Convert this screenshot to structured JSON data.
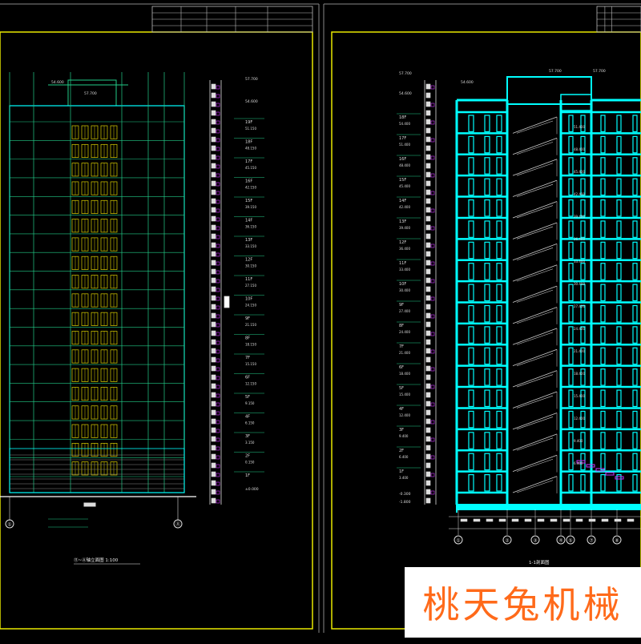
{
  "colors": {
    "background": "#000000",
    "frame": "#e8e800",
    "structure": "#00ffff",
    "elevation": "#22cc88",
    "stairs": "#cccccc",
    "highlight": "#cc33ff",
    "text": "#dddddd",
    "watermark_text": "#ff6a1a"
  },
  "left_sheet": {
    "top_elevation": "57.700",
    "roof_elevation": "54.600",
    "ground_elevation": "±0.000",
    "floor_labels": [
      "19F",
      "18F",
      "17F",
      "16F",
      "15F",
      "14F",
      "13F",
      "12F",
      "11F",
      "10F",
      "9F",
      "8F",
      "7F",
      "6F",
      "5F",
      "4F",
      "3F",
      "2F",
      "1F"
    ],
    "floor_elevations": [
      "51.150",
      "48.150",
      "45.150",
      "42.150",
      "39.150",
      "36.150",
      "33.150",
      "30.150",
      "27.150",
      "24.150",
      "21.150",
      "18.150",
      "15.150",
      "12.150",
      "9.150",
      "6.150",
      "3.150",
      "0.150"
    ],
    "axis_left": "①",
    "axis_right": "Ⓐ",
    "title": "⑪~Ⓐ轴立面图  1:100"
  },
  "right_sheet": {
    "top_elevation": "57.700",
    "roof_elevation": "54.600",
    "floor_labels": [
      "18F",
      "17F",
      "16F",
      "15F",
      "14F",
      "13F",
      "12F",
      "11F",
      "10F",
      "9F",
      "8F",
      "7F",
      "6F",
      "5F",
      "4F",
      "3F",
      "2F",
      "1F"
    ],
    "floor_elevations": [
      "54.400",
      "51.400",
      "48.400",
      "45.400",
      "42.400",
      "39.400",
      "36.400",
      "33.400",
      "30.400",
      "27.400",
      "24.400",
      "21.400",
      "18.400",
      "15.400",
      "12.400",
      "9.400",
      "6.400",
      "3.400"
    ],
    "basement_elevations": [
      "-0.300",
      "-1.800"
    ],
    "axis_labels": [
      "①",
      "②",
      "③",
      "④",
      "⑤",
      "⑦",
      "⑧"
    ],
    "title": "1-1剖面图"
  },
  "watermark": {
    "text": "桃天兔机械"
  }
}
